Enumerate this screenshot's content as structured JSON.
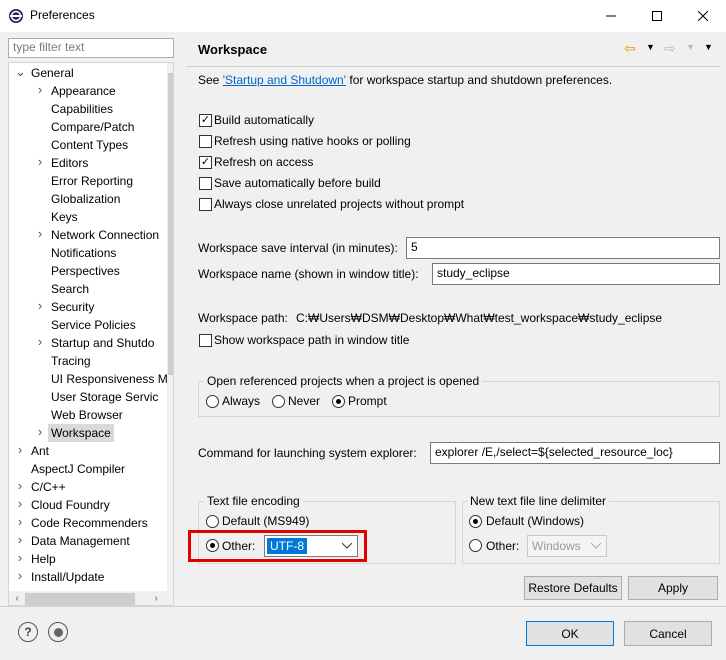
{
  "window": {
    "title": "Preferences",
    "min": "—",
    "max": "☐",
    "close": "✕"
  },
  "filter": {
    "placeholder": "type filter text"
  },
  "tree": [
    {
      "label": "General",
      "twist": "v"
    },
    {
      "label": "Appearance",
      "twist": ">"
    },
    {
      "label": "Capabilities",
      "twist": ""
    },
    {
      "label": "Compare/Patch",
      "twist": ""
    },
    {
      "label": "Content Types",
      "twist": ""
    },
    {
      "label": "Editors",
      "twist": ">"
    },
    {
      "label": "Error Reporting",
      "twist": ""
    },
    {
      "label": "Globalization",
      "twist": ""
    },
    {
      "label": "Keys",
      "twist": ""
    },
    {
      "label": "Network Connection",
      "twist": ">"
    },
    {
      "label": "Notifications",
      "twist": ""
    },
    {
      "label": "Perspectives",
      "twist": ""
    },
    {
      "label": "Search",
      "twist": ""
    },
    {
      "label": "Security",
      "twist": ">"
    },
    {
      "label": "Service Policies",
      "twist": ""
    },
    {
      "label": "Startup and Shutdo",
      "twist": ">"
    },
    {
      "label": "Tracing",
      "twist": ""
    },
    {
      "label": "UI Responsiveness M",
      "twist": ""
    },
    {
      "label": "User Storage Servic",
      "twist": ""
    },
    {
      "label": "Web Browser",
      "twist": ""
    },
    {
      "label": "Workspace",
      "twist": ">"
    },
    {
      "label": "Ant",
      "twist": ">"
    },
    {
      "label": "AspectJ Compiler",
      "twist": ""
    },
    {
      "label": "C/C++",
      "twist": ">"
    },
    {
      "label": "Cloud Foundry",
      "twist": ">"
    },
    {
      "label": "Code Recommenders",
      "twist": ">"
    },
    {
      "label": "Data Management",
      "twist": ">"
    },
    {
      "label": "Help",
      "twist": ">"
    },
    {
      "label": "Install/Update",
      "twist": ">"
    }
  ],
  "panel": {
    "title": "Workspace",
    "see_prefix": "See ",
    "see_link": "'Startup and Shutdown'",
    "see_suffix": " for workspace startup and shutdown preferences.",
    "checks": [
      {
        "label": "Build automatically",
        "checked": true
      },
      {
        "label": "Refresh using native hooks or polling",
        "checked": false
      },
      {
        "label": "Refresh on access",
        "checked": true
      },
      {
        "label": "Save automatically before build",
        "checked": false
      },
      {
        "label": "Always close unrelated projects without prompt",
        "checked": false
      }
    ],
    "save_interval_label": "Workspace save interval (in minutes):",
    "save_interval_value": "5",
    "ws_name_label": "Workspace name (shown in window title):",
    "ws_name_value": "study_eclipse",
    "ws_path_label": "Workspace path:",
    "ws_path_value": "C:₩Users₩DSM₩Desktop₩What₩test_workspace₩study_eclipse",
    "show_path_label": "Show workspace path in window title",
    "open_ref_title": "Open referenced projects when a project is opened",
    "open_ref_options": [
      "Always",
      "Never",
      "Prompt"
    ],
    "open_ref_selected": "Prompt",
    "cmd_label": "Command for launching system explorer:",
    "cmd_value": "explorer /E,/select=${selected_resource_loc}",
    "encoding_title": "Text file encoding",
    "encoding_default": "Default (MS949)",
    "encoding_other": "Other:",
    "encoding_value": "UTF-8",
    "delim_title": "New text file line delimiter",
    "delim_default": "Default (Windows)",
    "delim_other": "Other:",
    "delim_value": "Windows",
    "restore_label": "Restore Defaults",
    "apply_label": "Apply"
  },
  "footer": {
    "help": "?",
    "ok": "OK",
    "cancel": "Cancel"
  }
}
